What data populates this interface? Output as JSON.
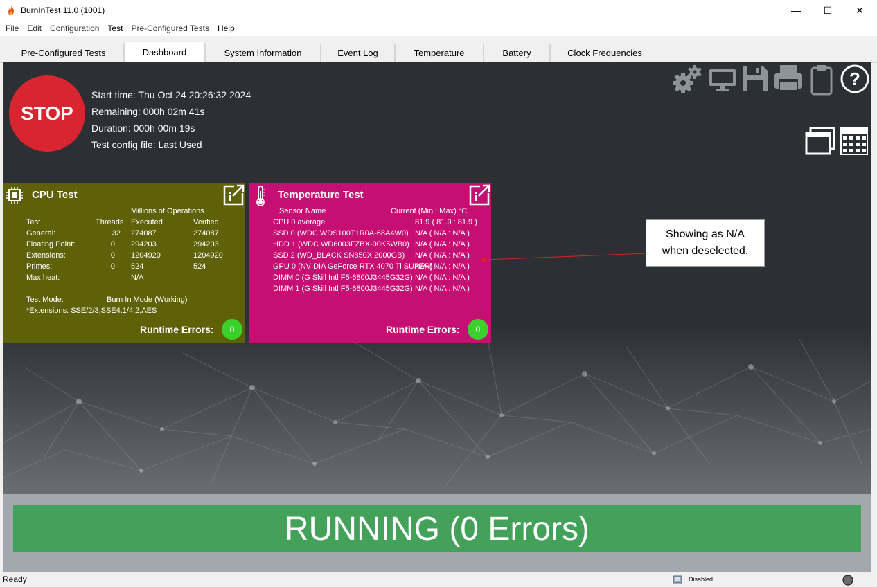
{
  "window": {
    "title": "BurnInTest 11.0 (1001)",
    "controls": {
      "minimize": "—",
      "maximize": "☐",
      "close": "✕"
    }
  },
  "menu": [
    "File",
    "Edit",
    "Configuration",
    "Test",
    "Pre-Configured Tests",
    "Help"
  ],
  "tabs": [
    {
      "label": "Pre-Configured Tests",
      "active": false
    },
    {
      "label": "Dashboard",
      "active": true
    },
    {
      "label": "System Information",
      "active": false
    },
    {
      "label": "Event Log",
      "active": false
    },
    {
      "label": "Temperature",
      "active": false
    },
    {
      "label": "Battery",
      "active": false
    },
    {
      "label": "Clock Frequencies",
      "active": false
    }
  ],
  "dashboard": {
    "stop_label": "STOP",
    "info": {
      "start_time": "Start time: Thu Oct 24 20:26:32 2024",
      "remaining": "Remaining: 000h 02m 41s",
      "duration": "Duration: 000h 00m 19s",
      "config": "Test config file: Last Used"
    },
    "toolbar_icons": [
      "gears-icon",
      "monitor-icon",
      "save-icon",
      "printer-icon",
      "clipboard-icon",
      "help-icon"
    ],
    "view_icons": [
      "windows-view-icon",
      "grid-view-icon"
    ]
  },
  "cpu_card": {
    "title": "CPU Test",
    "header_top": "Millions of Operations",
    "columns": [
      "Test",
      "Threads",
      "Executed",
      "Verified"
    ],
    "rows": [
      {
        "test": "General:",
        "threads": "32",
        "executed": "274087",
        "verified": "274087"
      },
      {
        "test": "Floating Point:",
        "threads": "0",
        "executed": "294203",
        "verified": "294203"
      },
      {
        "test": "Extensions:",
        "threads": "0",
        "executed": "1204920",
        "verified": "1204920"
      },
      {
        "test": "Primes:",
        "threads": "0",
        "executed": "524",
        "verified": "524"
      },
      {
        "test": "Max heat:",
        "threads": "",
        "executed": "N/A",
        "verified": ""
      }
    ],
    "test_mode_label": "Test Mode:",
    "test_mode_value": "Burn In Mode (Working)",
    "extensions_note": "*Extensions: SSE/2/3,SSE4.1/4.2,AES",
    "runtime_errors_label": "Runtime Errors:",
    "runtime_errors_value": "0",
    "color": "#5f6109"
  },
  "temp_card": {
    "title": "Temperature Test",
    "col_sensor": "Sensor Name",
    "col_current": "Current (Min : Max) °C",
    "rows": [
      {
        "name": "CPU 0 average",
        "value": "81.9 ( 81.9 : 81.9 )"
      },
      {
        "name": "SSD 0 (WDC WDS100T1R0A-68A4W0)",
        "value": "N/A ( N/A : N/A )"
      },
      {
        "name": "HDD 1 (WDC WD6003FZBX-00K5WB0)",
        "value": "N/A ( N/A : N/A )"
      },
      {
        "name": "SSD 2 (WD_BLACK SN850X 2000GB)",
        "value": "N/A ( N/A : N/A )"
      },
      {
        "name": "GPU 0 (NVIDIA GeForce RTX 4070 Ti SUPER)",
        "value": "N/A ( N/A : N/A )"
      },
      {
        "name": "DIMM 0 (G Skill Intl F5-6800J3445G32G)",
        "value": "N/A ( N/A : N/A )"
      },
      {
        "name": "DIMM 1 (G Skill Intl F5-6800J3445G32G)",
        "value": "N/A ( N/A : N/A )"
      }
    ],
    "runtime_errors_label": "Runtime Errors:",
    "runtime_errors_value": "0",
    "color": "#c60f72"
  },
  "callout": {
    "line1": "Showing as N/A",
    "line2": "when deselected."
  },
  "running_status": "RUNNING (0 Errors)",
  "statusbar": {
    "left": "Ready",
    "middle": "Disabled"
  }
}
